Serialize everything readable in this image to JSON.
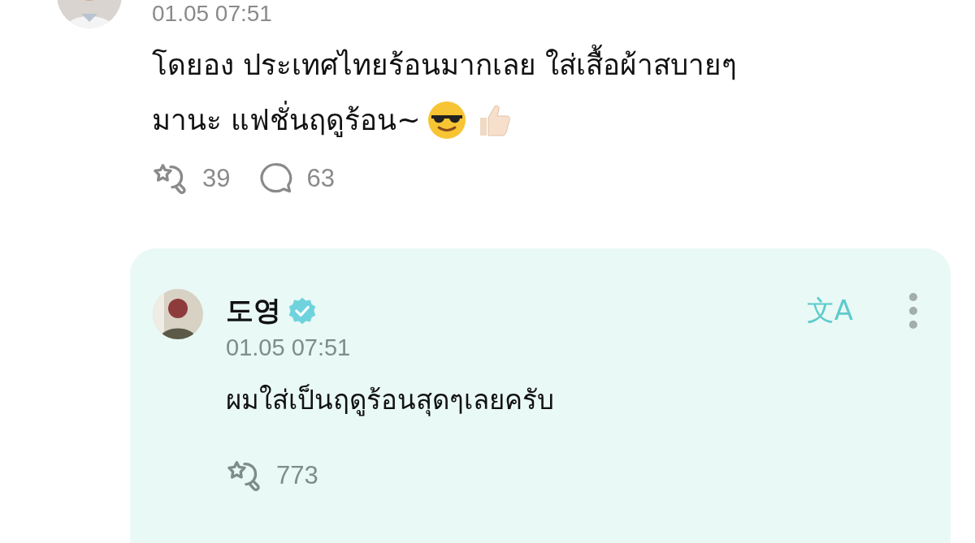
{
  "post": {
    "date": "01.05 07:51",
    "text_lines": [
      "โดยอง ประเทศไทยร้อนมากเลย ใส่เสื้อผ้าสบายๆ",
      "มานะ แฟชั่นฤดูร้อน~"
    ],
    "emoji": [
      {
        "kind": "sunglasses"
      },
      {
        "kind": "thumbs_up"
      }
    ],
    "likes": "39",
    "comments": "63"
  },
  "reply": {
    "name": "도영",
    "verified": true,
    "translate_icon": "文A",
    "date": "01.05 07:51",
    "text": "ผมใส่เป็นฤดูร้อนสุดๆเลยครับ",
    "likes": "773"
  }
}
